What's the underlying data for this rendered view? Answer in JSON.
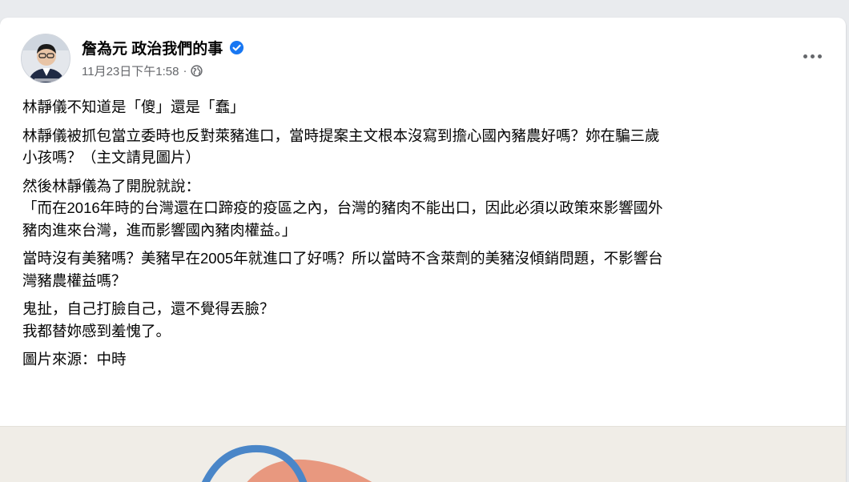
{
  "post": {
    "author": "詹為元 政治我們的事",
    "timestamp": "11月23日下午1:58",
    "separator": "·",
    "icons": {
      "verified": "verified-badge-icon",
      "audience": "globe-icon",
      "more": "more-options-icon"
    },
    "colors": {
      "verified": "#1877f2",
      "meta": "#65676b",
      "arc_blue": "#4a86c8",
      "arc_salmon": "#e8987f"
    },
    "paragraphs": [
      "林靜儀不知道是「傻」還是「蠢」",
      "林靜儀被抓包當立委時也反對萊豬進口，當時提案主文根本沒寫到擔心國內豬農好嗎？妳在騙三歲\n小孩嗎？（主文請見圖片）",
      "然後林靜儀為了開脫就說：\n「而在2016年時的台灣還在口蹄疫的疫區之內，台灣的豬肉不能出口，因此必須以政策來影響國外\n豬肉進來台灣，進而影響國內豬肉權益。」",
      "當時沒有美豬嗎？美豬早在2005年就進口了好嗎？所以當時不含萊劑的美豬沒傾銷問題，不影響台\n灣豬農權益嗎？",
      "鬼扯，自己打臉自己，還不覺得丟臉？\n我都替妳感到羞愧了。",
      "圖片來源：中時"
    ]
  }
}
